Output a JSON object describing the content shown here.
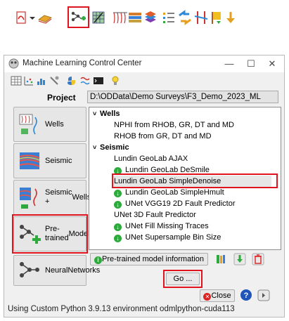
{
  "window": {
    "title": "Machine Learning Control Center",
    "controls": [
      "—",
      "☐",
      "✕"
    ]
  },
  "project": {
    "label": "Project",
    "value": "D:\\ODData\\Demo Surveys\\F3_Demo_2023_ML"
  },
  "sidebar": {
    "items": [
      {
        "label": "Wells",
        "icon": "wells-icon"
      },
      {
        "label": "Seismic",
        "icon": "seismic-icon"
      },
      {
        "label": "Seismic +\nWells",
        "line1": "Seismic +",
        "line2": "Wells",
        "icon": "seismic-wells-icon"
      },
      {
        "label": "Pre-trained Models",
        "line1": "Pre-trained",
        "line2": "Models",
        "icon": "pretrained-models-icon"
      },
      {
        "label": "Neural Networks",
        "line1": "Neural",
        "line2": "Networks",
        "icon": "neural-networks-icon"
      }
    ]
  },
  "tree": {
    "groups": [
      {
        "label": "Wells",
        "items": [
          "NPHI from RHOB, GR, DT and MD",
          "RHOB from GR, DT and MD"
        ]
      },
      {
        "label": "Seismic",
        "items": [
          {
            "text": "Lundin GeoLab AJAX",
            "icon": false
          },
          {
            "text": "Lundin GeoLab DeSmile",
            "icon": true
          },
          {
            "text": "Lundin GeoLab SimpleDenoise",
            "icon": false,
            "selected": true
          },
          {
            "text": "Lundin GeoLab SimpleHmult",
            "icon": true
          },
          {
            "text": "UNet VGG19 2D Fault Predictor",
            "icon": true
          },
          {
            "text": "UNet 3D Fault Predictor",
            "icon": false
          },
          {
            "text": "UNet Fill Missing Traces",
            "icon": true
          },
          {
            "text": "UNet Supersample Bin Size",
            "icon": true
          }
        ]
      }
    ]
  },
  "buttons": {
    "info": "Pre-trained model information",
    "go": "Go ...",
    "close": "Close"
  },
  "status": "Using Custom Python 3.9.13 environment odmlpython-cuda113",
  "colors": {
    "highlight": "#e0141e",
    "ok_green": "#2eaa3c",
    "window_bg": "#f0f0f0"
  }
}
